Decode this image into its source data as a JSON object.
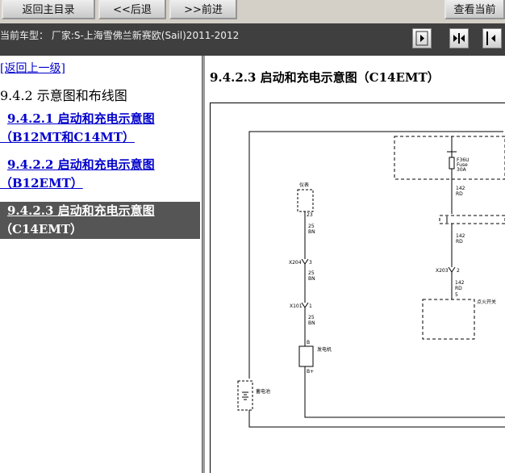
{
  "toolbar": {
    "buttons": [
      {
        "label": "返回主目录",
        "icon": "home-icon"
      },
      {
        "label": "<<后退",
        "icon": "back-icon"
      },
      {
        "label": ">>前进",
        "icon": "forward-icon"
      },
      {
        "label": "查看当前"
      }
    ]
  },
  "info_bar": {
    "car_text": "当前车型：  厂家:S-上海雪佛兰新赛欧(Sail)2011-2012",
    "nav_icons": [
      "expand-left-icon",
      "fit-icon",
      "expand-right-icon"
    ]
  },
  "left": {
    "back_link": "[返回上一级]",
    "heading": "9.4.2 示意图和布线图",
    "items": [
      {
        "line1": "9.4.2.1 启动和充电示意图",
        "line2": "（B12MT和C14MT）"
      },
      {
        "line1": "9.4.2.2 启动和充电示意图",
        "line2": "（B12EMT）"
      },
      {
        "line1": "9.4.2.3 启动和充电示意图",
        "line2": "（C14EMT）"
      }
    ]
  },
  "right": {
    "title": "9.4.2.3 启动和充电示意图（C14EMT）",
    "diagram": {
      "fuse_name": "F36U",
      "fuse_word": "Fuse",
      "fuse_rating": "30A",
      "wire_142": "142",
      "wire_rd": "RD",
      "wire_25": "25",
      "wire_bn": "BN",
      "instrument": "仪表",
      "pin_23": "23",
      "conn_x204": "X204",
      "pin_3": "3",
      "conn_x101": "X101",
      "pin_1": "1",
      "conn_x203": "X203",
      "pin_2": "2",
      "pin_5": "5",
      "ignition": "点火开关",
      "generator": "发电机",
      "pin_b": "B",
      "pin_bplus": "B+",
      "battery": "蓄电池"
    }
  }
}
